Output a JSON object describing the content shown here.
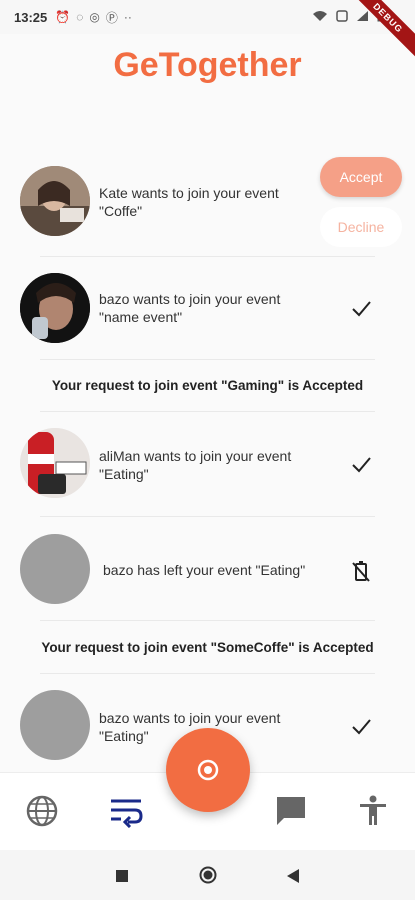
{
  "status_bar": {
    "time": "13:25",
    "left_icons": [
      "alarm-icon",
      "cast-icon",
      "whatsapp-icon",
      "p-icon",
      "more-dots-icon"
    ],
    "right_icons": [
      "wifi-icon",
      "sim-icon",
      "signal-icon",
      "battery-icon"
    ],
    "debug_label": "DEBUG"
  },
  "header": {
    "title": "GeTogether"
  },
  "notifications": [
    {
      "type": "join_request",
      "user": "Kate",
      "text": "Kate wants to join your event \"Coffe\"",
      "avatar": "photo-kate",
      "actions": {
        "accept": "Accept",
        "decline": "Decline"
      }
    },
    {
      "type": "join_request",
      "user": "bazo",
      "text": "bazo wants to join your event \"name event\"",
      "avatar": "photo-bazo",
      "status_icon": "check-icon"
    },
    {
      "type": "info",
      "text": "Your request to join event \"Gaming\" is Accepted"
    },
    {
      "type": "join_request",
      "user": "aliMan",
      "text": "aliMan wants to join your event \"Eating\"",
      "avatar": "photo-coke",
      "status_icon": "check-icon"
    },
    {
      "type": "left",
      "user": "bazo",
      "text": "bazo has left your event \"Eating\"",
      "avatar": "placeholder-grey",
      "status_icon": "no-battery-icon"
    },
    {
      "type": "info",
      "text": "Your request to join event \"SomeCoffe\" is Accepted"
    },
    {
      "type": "join_request",
      "user": "bazo",
      "text": "bazo wants to join your event \"Eating\"",
      "avatar": "placeholder-grey",
      "status_icon": "check-icon"
    }
  ],
  "bottom_nav": {
    "items": [
      "globe-icon",
      "wrap-text-icon",
      "chat-icon",
      "accessibility-icon"
    ],
    "active_index": 1,
    "fab_icon": "target-icon"
  },
  "system_nav": [
    "square-icon",
    "circle-icon",
    "back-triangle-icon"
  ],
  "colors": {
    "brand": "#f26d42",
    "accept_button": "#f5a087",
    "decline_text": "#f5b3a0",
    "active_nav": "#1a2a8a"
  }
}
